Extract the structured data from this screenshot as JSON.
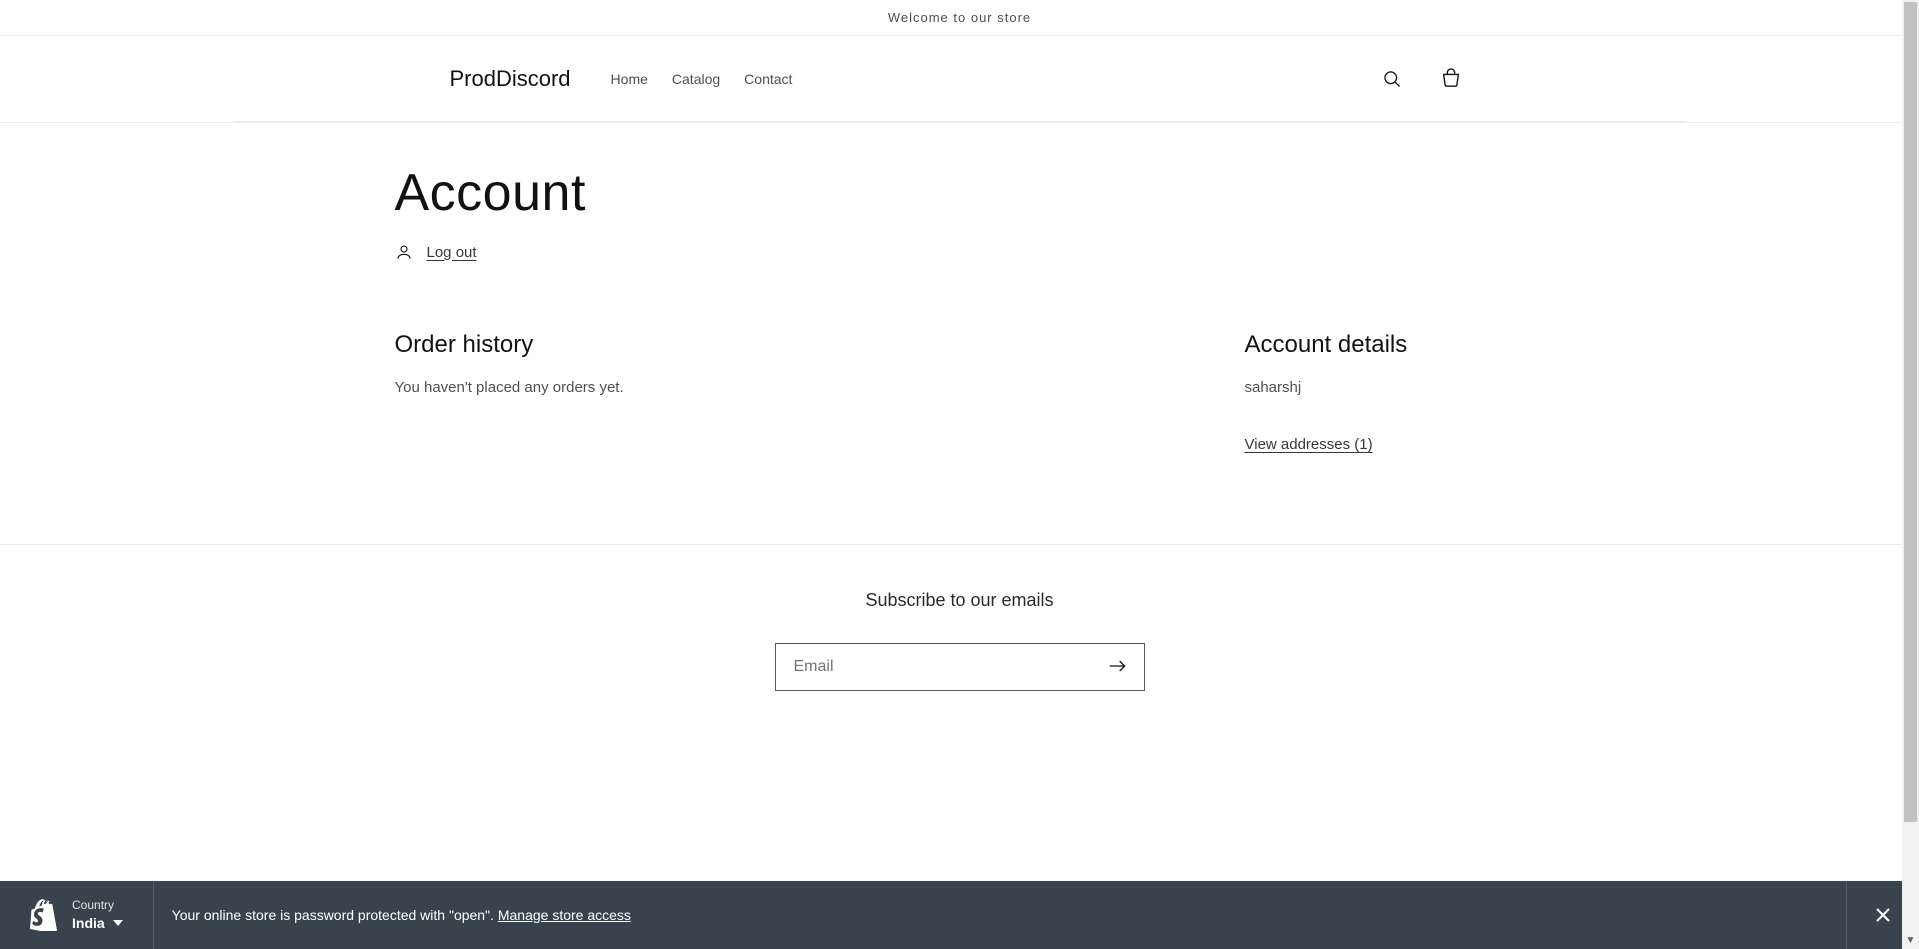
{
  "announcement": "Welcome to our store",
  "logo": "ProdDiscord",
  "nav": {
    "home": "Home",
    "catalog": "Catalog",
    "contact": "Contact"
  },
  "page": {
    "title": "Account",
    "logout": "Log out"
  },
  "order_history": {
    "title": "Order history",
    "empty": "You haven't placed any orders yet."
  },
  "account_details": {
    "title": "Account details",
    "name": "saharshj",
    "view_addresses": "View addresses (1)"
  },
  "footer": {
    "subscribe_title": "Subscribe to our emails",
    "email_placeholder": "Email"
  },
  "bottom_bar": {
    "country_label": "Country",
    "country_value": "India",
    "message": "Your online store is password protected with \"open\". ",
    "manage_link": "Manage store access"
  }
}
